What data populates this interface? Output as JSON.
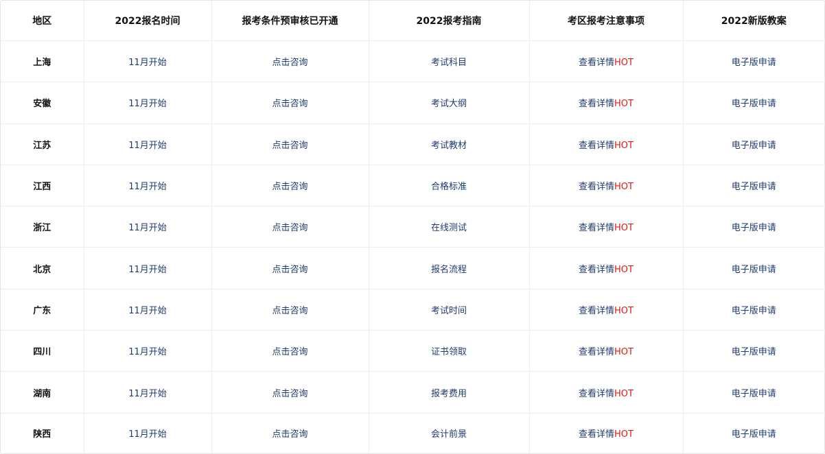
{
  "headers": [
    "地区",
    "2022报名时间",
    "报考条件预审核已开通",
    "2022报考指南",
    "考区报考注意事项",
    "2022新版教案"
  ],
  "rows": [
    {
      "region": "上海",
      "time": "11月开始",
      "consult": "点击咨询",
      "guide": "考试科目",
      "notice": "查看详情",
      "hot": "HOT",
      "plan": "电子版申请"
    },
    {
      "region": "安徽",
      "time": "11月开始",
      "consult": "点击咨询",
      "guide": "考试大纲",
      "notice": "查看详情",
      "hot": "HOT",
      "plan": "电子版申请"
    },
    {
      "region": "江苏",
      "time": "11月开始",
      "consult": "点击咨询",
      "guide": "考试教材",
      "notice": "查看详情",
      "hot": "HOT",
      "plan": "电子版申请"
    },
    {
      "region": "江西",
      "time": "11月开始",
      "consult": "点击咨询",
      "guide": "合格标准",
      "notice": "查看详情",
      "hot": "HOT",
      "plan": "电子版申请"
    },
    {
      "region": "浙江",
      "time": "11月开始",
      "consult": "点击咨询",
      "guide": "在线测试",
      "notice": "查看详情",
      "hot": "HOT",
      "plan": "电子版申请"
    },
    {
      "region": "北京",
      "time": "11月开始",
      "consult": "点击咨询",
      "guide": "报名流程",
      "notice": "查看详情",
      "hot": "HOT",
      "plan": "电子版申请"
    },
    {
      "region": "广东",
      "time": "11月开始",
      "consult": "点击咨询",
      "guide": "考试时间",
      "notice": "查看详情",
      "hot": "HOT",
      "plan": "电子版申请"
    },
    {
      "region": "四川",
      "time": "11月开始",
      "consult": "点击咨询",
      "guide": "证书领取",
      "notice": "查看详情",
      "hot": "HOT",
      "plan": "电子版申请"
    },
    {
      "region": "湖南",
      "time": "11月开始",
      "consult": "点击咨询",
      "guide": "报考费用",
      "notice": "查看详情",
      "hot": "HOT",
      "plan": "电子版申请"
    },
    {
      "region": "陕西",
      "time": "11月开始",
      "consult": "点击咨询",
      "guide": "会计前景",
      "notice": "查看详情",
      "hot": "HOT",
      "plan": "电子版申请"
    }
  ],
  "colors": {
    "link": "#1f3a6e",
    "hot": "#e01a10",
    "header_text": "#111111",
    "border": "#ececec"
  }
}
